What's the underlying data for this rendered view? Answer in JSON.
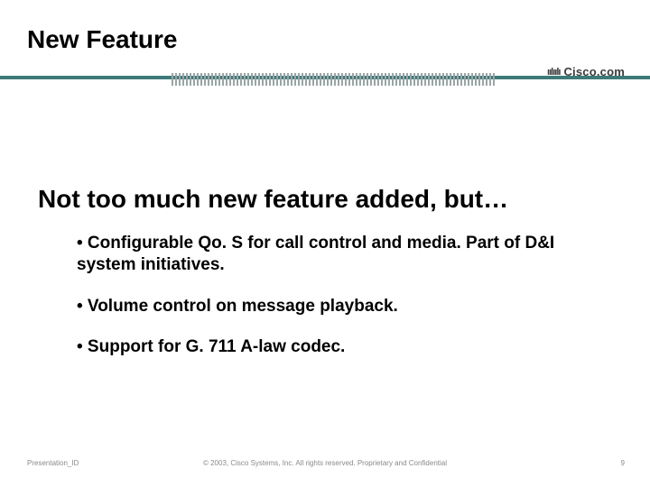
{
  "slide": {
    "title": "New Feature",
    "headline": "Not too much new feature added, but…",
    "bullets": [
      "• Configurable Qo. S for call control and media. Part of D&I system initiatives.",
      "• Volume control on message playback.",
      "• Support for G. 711 A-law codec."
    ]
  },
  "footer": {
    "presentation_id": "Presentation_ID",
    "copyright": "© 2003, Cisco Systems, Inc. All rights reserved. Proprietary and Confidential",
    "page_number": "9"
  },
  "brand": {
    "logo_text": "Cisco.com"
  }
}
